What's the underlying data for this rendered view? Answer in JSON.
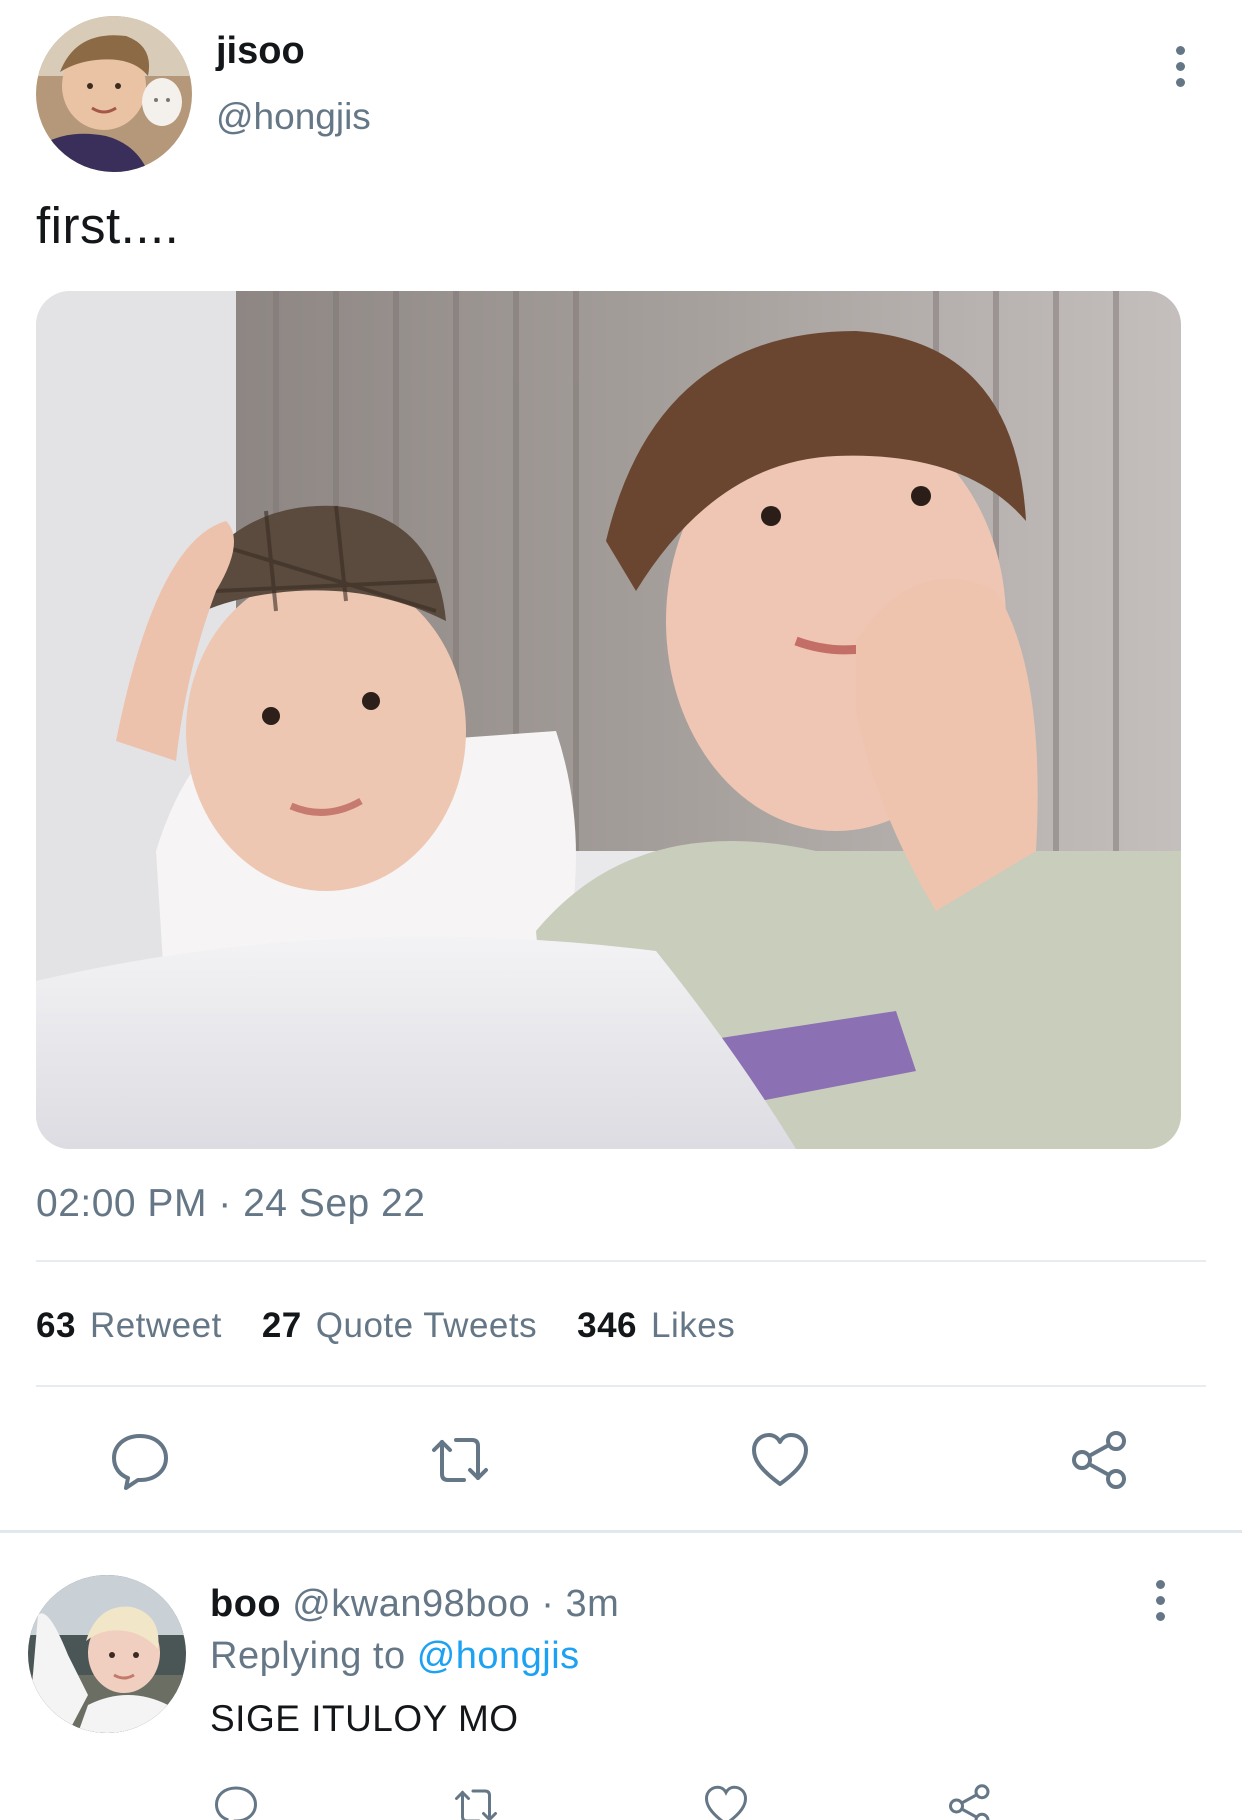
{
  "tweet": {
    "display_name": "jisoo",
    "handle": "@hongjis",
    "text": "first....",
    "timestamp": "02:00 PM · 24 Sep 22",
    "stats": {
      "retweets_count": "63",
      "retweets_label": "Retweet",
      "quotes_count": "27",
      "quotes_label": "Quote Tweets",
      "likes_count": "346",
      "likes_label": "Likes"
    },
    "actions": [
      "reply-icon",
      "retweet-icon",
      "like-icon",
      "share-icon"
    ]
  },
  "reply": {
    "display_name": "boo",
    "handle": "@kwan98boo",
    "time": "· 3m",
    "replying_prefix": "Replying to",
    "replying_mention": "@hongjis",
    "text": "SIGE ITULOY MO"
  },
  "colors": {
    "text_primary": "#14171a",
    "text_secondary": "#657786",
    "link": "#1da1f2",
    "divider": "#e6ecf0"
  }
}
